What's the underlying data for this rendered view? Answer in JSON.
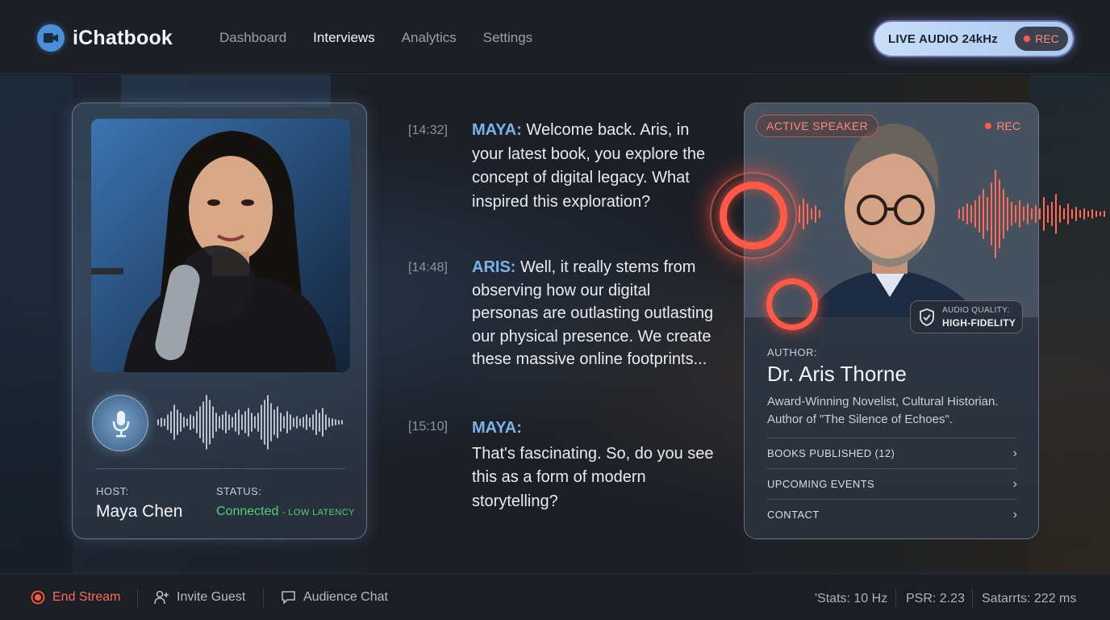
{
  "app": {
    "name": "iChatbook"
  },
  "nav": [
    "Dashboard",
    "Interviews",
    "Analytics",
    "Settings"
  ],
  "live": {
    "label": "LIVE AUDIO 24kHz",
    "rec": "REC"
  },
  "host": {
    "label": "HOST:",
    "name": "Maya Chen",
    "status_label": "STATUS:",
    "status": "Connected",
    "status_sub": "- LOW LATENCY"
  },
  "transcript": [
    {
      "time": "[14:32]",
      "speaker": "MAYA:",
      "text": " Welcome back. Aris, in your latest book, you explore the concept of digital legacy. What inspired this exploration?"
    },
    {
      "time": "[14:48]",
      "speaker": "ARIS:",
      "text": " Well, it really stems from observing how our digital personas are outlasting outlasting our physical presence. We create these massive online footprints..."
    },
    {
      "time": "[15:10]",
      "speaker": "MAYA:",
      "text": "That's fascinating. So, do you see this as a form of modern storytelling?"
    }
  ],
  "guest": {
    "active": "ACTIVE SPEAKER",
    "rec": "REC",
    "quality_label": "AUDIO QUALITY:",
    "quality_value": "HIGH-FIDELITY",
    "author_label": "AUTHOR:",
    "name": "Dr. Aris Thorne",
    "bio": "Award-Winning Novelist, Cultural Historian. Author of \"The Silence of Echoes\".",
    "links": [
      "BOOKS PUBLISHED (12)",
      "UPCOMING EVENTS",
      "CONTACT"
    ]
  },
  "footer": {
    "end": "End Stream",
    "invite": "Invite Guest",
    "chat": "Audience Chat",
    "stats": [
      "'Stats: 10 Hz",
      "PSR: 2.23",
      "Satarrts: 222 ms"
    ]
  },
  "colors": {
    "accent_blue": "#4a90d9",
    "rec_red": "#ff5a48",
    "connected_green": "#4fd17a",
    "speaker_blue": "#7ab3e8"
  },
  "icons": [
    "video-chat-icon",
    "microphone-icon",
    "shield-check-icon",
    "chevron-right-icon",
    "record-icon",
    "add-user-icon",
    "chat-bubble-icon"
  ]
}
